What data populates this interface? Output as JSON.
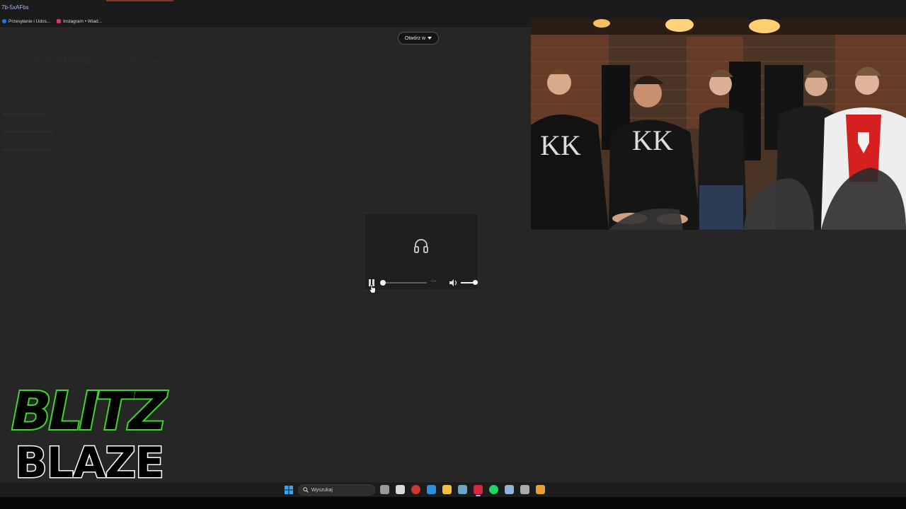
{
  "browser": {
    "url_fragment": "7b-5xAFbs",
    "bookmarks": [
      {
        "label": "Przesyłanie i Udos...",
        "icon": "facebook-icon",
        "color": "#1877f2"
      },
      {
        "label": "Instagram • Wiad...",
        "icon": "instagram-icon",
        "color": "#e1306c"
      }
    ]
  },
  "viewer": {
    "open_button_label": "Otwórz w",
    "ghost_texts": [
      "BLITZ KLIDA 8OCE18",
      "# prod. 44ye"
    ],
    "player": {
      "icon": "headphones-icon",
      "state": "playing",
      "progress": 0.0,
      "volume": 1.0,
      "time_label": "-:--"
    }
  },
  "overlay": {
    "logo_line1": "BLITZ",
    "logo_line2": "BLAZE",
    "logo_color": "#3fd62a"
  },
  "taskbar": {
    "search_placeholder": "Wyszukaj",
    "apps": [
      {
        "name": "task-view-icon",
        "color": "#9a9a9a"
      },
      {
        "name": "calendar-icon",
        "color": "#d9d9d9"
      },
      {
        "name": "browser-icon",
        "color": "#c83a30"
      },
      {
        "name": "vscode-icon",
        "color": "#2f8fd8"
      },
      {
        "name": "file-explorer-icon",
        "color": "#f0c040"
      },
      {
        "name": "app-icon",
        "color": "#6aa6c8"
      },
      {
        "name": "opera-icon",
        "color": "#d7263d"
      },
      {
        "name": "spotify-icon",
        "color": "#1ed760"
      },
      {
        "name": "app2-icon",
        "color": "#8fb3d9"
      },
      {
        "name": "app3-icon",
        "color": "#aaaaaa"
      },
      {
        "name": "app4-icon",
        "color": "#e8a030"
      }
    ]
  }
}
